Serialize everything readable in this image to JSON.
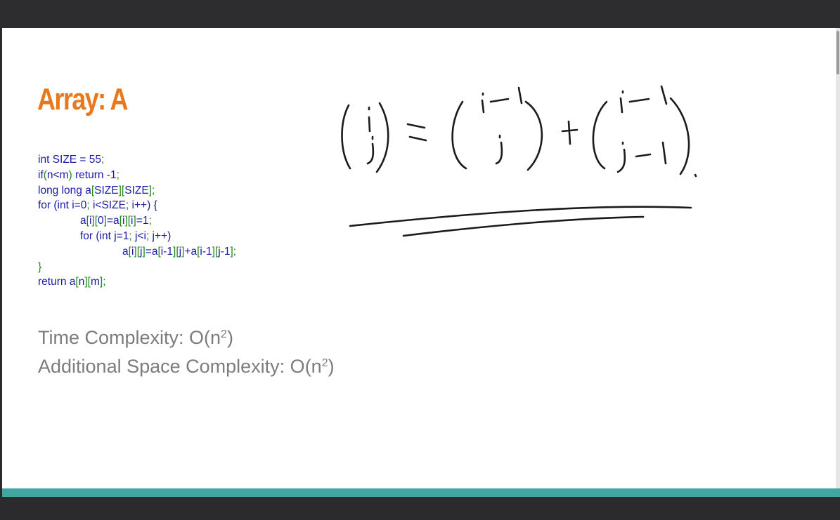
{
  "slide": {
    "title": "Array: A",
    "code_lines": [
      {
        "plain": "int SIZE = 55",
        "green": ";"
      },
      {
        "tokens": [
          {
            "t": "if",
            "c": "b"
          },
          {
            "t": "(",
            "c": "g"
          },
          {
            "t": "n<m",
            "c": "b"
          },
          {
            "t": ")",
            "c": "g"
          },
          {
            "t": " return -1",
            "c": "b"
          },
          {
            "t": ";",
            "c": "g"
          }
        ]
      },
      {
        "tokens": [
          {
            "t": "long long a",
            "c": "b"
          },
          {
            "t": "[",
            "c": "g"
          },
          {
            "t": "SIZE",
            "c": "b"
          },
          {
            "t": "][",
            "c": "g"
          },
          {
            "t": "SIZE",
            "c": "b"
          },
          {
            "t": "];",
            "c": "g"
          }
        ]
      },
      {
        "tokens": [
          {
            "t": "for (int i=0",
            "c": "b"
          },
          {
            "t": ";",
            "c": "g"
          },
          {
            "t": " i<SIZE",
            "c": "b"
          },
          {
            "t": ";",
            "c": "g"
          },
          {
            "t": " i++) {",
            "c": "b"
          }
        ]
      },
      {
        "indent": 1,
        "tokens": [
          {
            "t": "a",
            "c": "b"
          },
          {
            "t": "[",
            "c": "g"
          },
          {
            "t": "i",
            "c": "b"
          },
          {
            "t": "][",
            "c": "g"
          },
          {
            "t": "0",
            "c": "b"
          },
          {
            "t": "]",
            "c": "g"
          },
          {
            "t": "=a",
            "c": "b"
          },
          {
            "t": "[",
            "c": "g"
          },
          {
            "t": "i",
            "c": "b"
          },
          {
            "t": "][",
            "c": "g"
          },
          {
            "t": "i",
            "c": "b"
          },
          {
            "t": "]",
            "c": "g"
          },
          {
            "t": "=1",
            "c": "b"
          },
          {
            "t": ";",
            "c": "g"
          }
        ]
      },
      {
        "indent": 1,
        "tokens": [
          {
            "t": "for (int j=1",
            "c": "b"
          },
          {
            "t": ";",
            "c": "g"
          },
          {
            "t": " j<i",
            "c": "b"
          },
          {
            "t": ";",
            "c": "g"
          },
          {
            "t": " j++)",
            "c": "b"
          }
        ]
      },
      {
        "indent": 2,
        "tokens": [
          {
            "t": "a",
            "c": "b"
          },
          {
            "t": "[",
            "c": "g"
          },
          {
            "t": "i",
            "c": "b"
          },
          {
            "t": "][",
            "c": "g"
          },
          {
            "t": "j",
            "c": "b"
          },
          {
            "t": "]",
            "c": "g"
          },
          {
            "t": "=a",
            "c": "b"
          },
          {
            "t": "[",
            "c": "g"
          },
          {
            "t": "i-1",
            "c": "b"
          },
          {
            "t": "][",
            "c": "g"
          },
          {
            "t": "j",
            "c": "b"
          },
          {
            "t": "]",
            "c": "g"
          },
          {
            "t": "+a",
            "c": "b"
          },
          {
            "t": "[",
            "c": "g"
          },
          {
            "t": "i-1",
            "c": "b"
          },
          {
            "t": "][",
            "c": "g"
          },
          {
            "t": "j-1",
            "c": "b"
          },
          {
            "t": "];",
            "c": "g"
          }
        ]
      },
      {
        "tokens": [
          {
            "t": "}",
            "c": "g"
          }
        ]
      },
      {
        "tokens": [
          {
            "t": "return a",
            "c": "b"
          },
          {
            "t": "[",
            "c": "g"
          },
          {
            "t": "n",
            "c": "b"
          },
          {
            "t": "][",
            "c": "g"
          },
          {
            "t": "m",
            "c": "b"
          },
          {
            "t": "];",
            "c": "g"
          }
        ]
      }
    ],
    "time_complexity": {
      "label": "Time Complexity: O(n",
      "exp": "2",
      "close": ")"
    },
    "space_complexity": {
      "label": "Additional Space Complexity:  O(n",
      "exp": "2",
      "close": ")"
    }
  },
  "colors": {
    "title": "#e8781e",
    "code_blue": "#1a1aa6",
    "code_green": "#1e8a1e",
    "complexity_gray": "#7c7c7c",
    "accent_strip": "#3fa6a1",
    "frame": "#2b2b2d"
  },
  "icons": [
    "handwritten-binomial-formula"
  ]
}
